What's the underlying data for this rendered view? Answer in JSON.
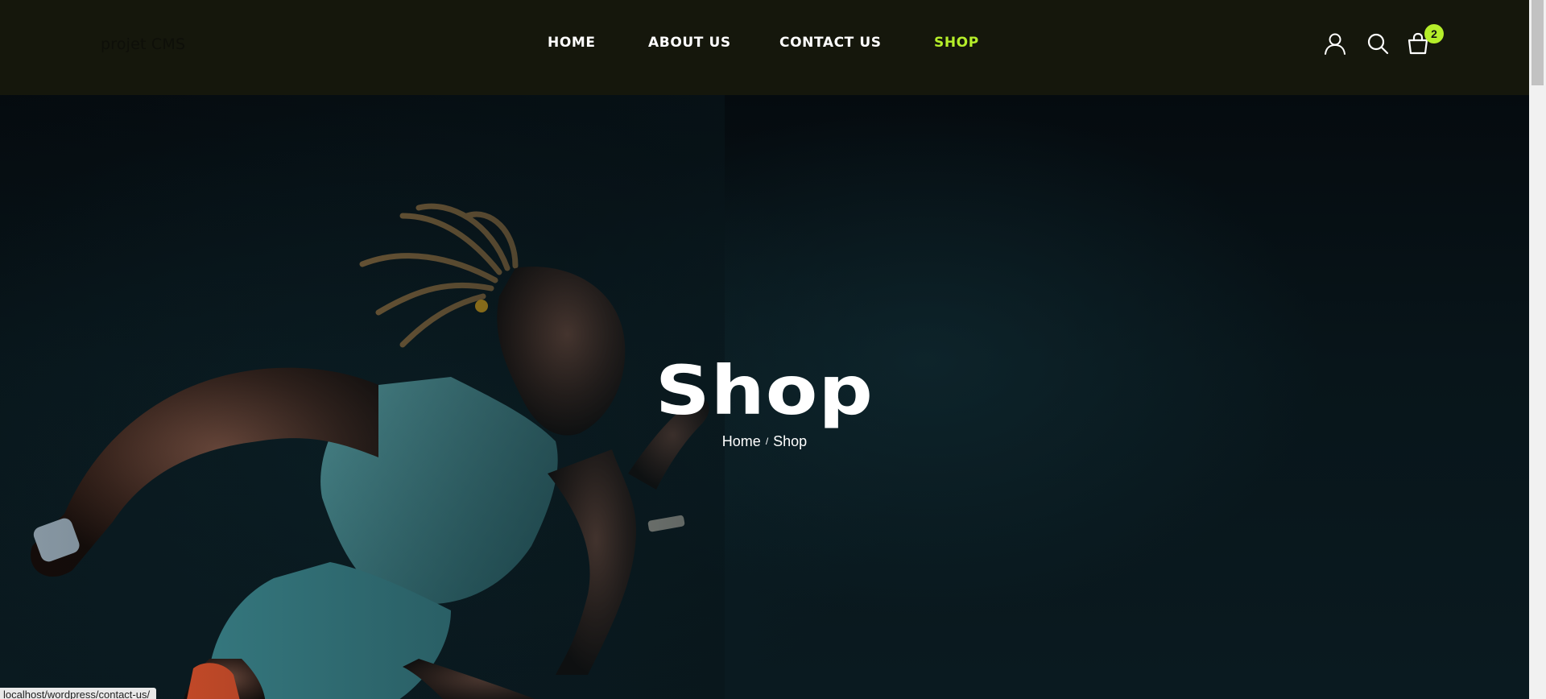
{
  "header": {
    "brand": "projet CMS",
    "nav": [
      {
        "label": "HOME",
        "active": false
      },
      {
        "label": "ABOUT US",
        "active": false
      },
      {
        "label": "CONTACT US",
        "active": false
      },
      {
        "label": "SHOP",
        "active": true
      }
    ],
    "icons": [
      "user-icon",
      "search-icon",
      "cart-icon"
    ],
    "cart_count": "2"
  },
  "hero": {
    "title": "Shop",
    "breadcrumb": {
      "home": "Home",
      "separator": "/",
      "current": "Shop"
    }
  },
  "status_bar": {
    "url": "localhost/wordpress/contact-us/"
  },
  "colors": {
    "header_bg": "#15170c",
    "accent": "#b5ee2a",
    "hero_bg": "#08151a"
  }
}
